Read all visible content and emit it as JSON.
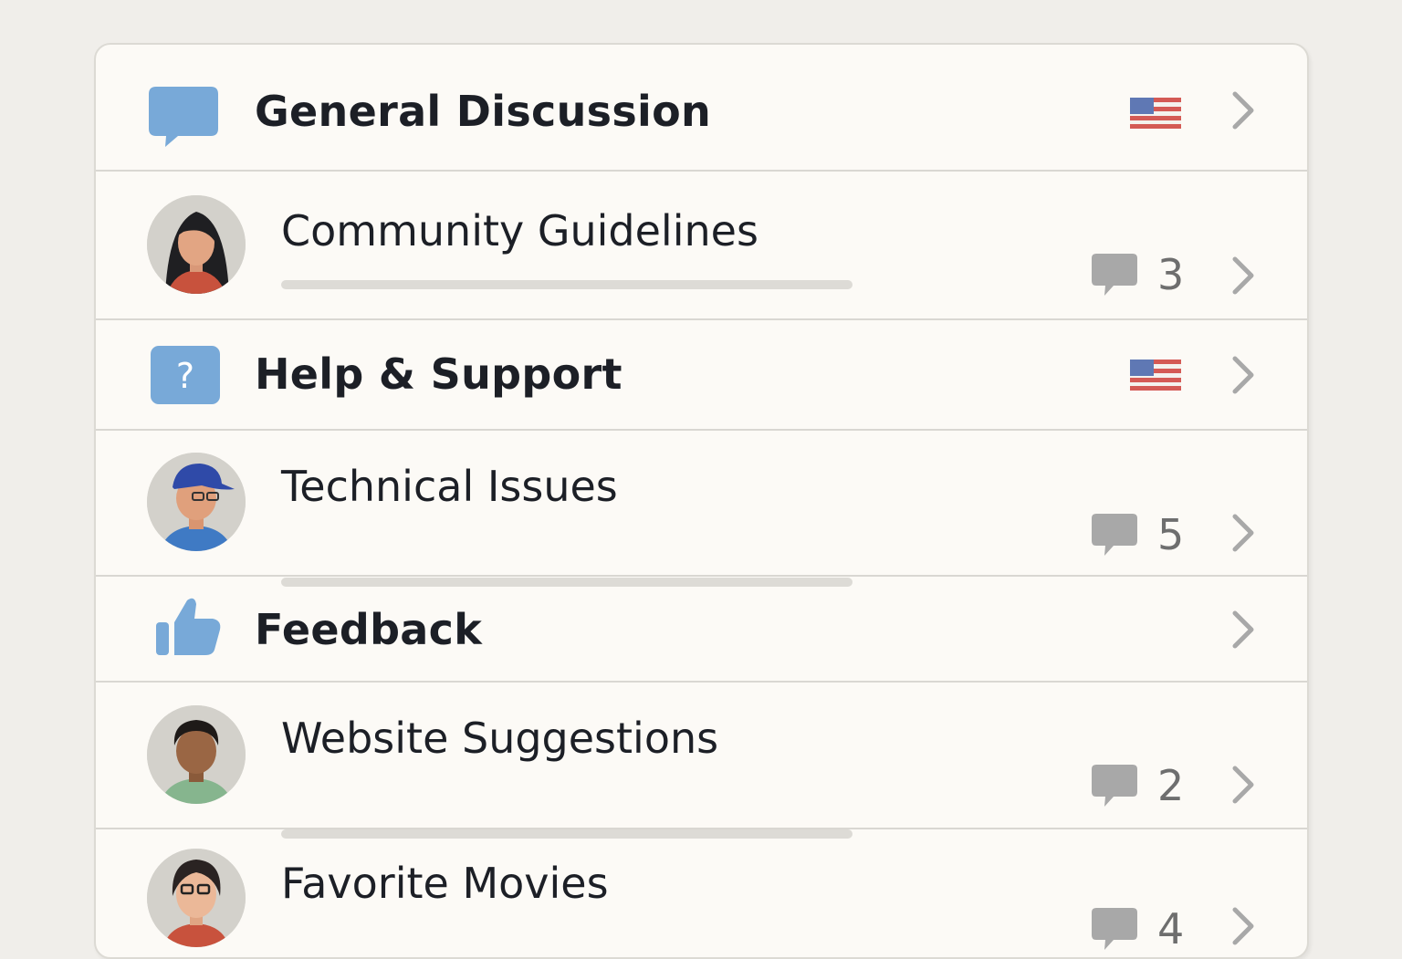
{
  "categories": [
    {
      "title": "General Discussion",
      "icon": "speech-bubble-icon",
      "flag": "us-flag-icon",
      "subforum": {
        "title": "Community Guidelines",
        "replies": "3",
        "avatar": "avatar-woman-dark-hair"
      }
    },
    {
      "title": "Help & Support",
      "icon": "question-icon",
      "flag": "us-flag-icon",
      "subforum": {
        "title": "Technical Issues",
        "replies": "5",
        "avatar": "avatar-man-blue-cap"
      }
    },
    {
      "title": "Feedback",
      "icon": "thumbs-up-icon",
      "subforum": {
        "title": "Website Suggestions",
        "replies": "2",
        "avatar": "avatar-man-green-shirt"
      }
    },
    {
      "title": "",
      "subforum": {
        "title": "Favorite Movies",
        "replies": "4",
        "avatar": "avatar-person-glasses"
      }
    }
  ],
  "colors": {
    "accent_blue": "#78a9d8",
    "reply_bubble": "#a8a8a8",
    "chevron": "#a8a8a8",
    "background": "#f0eeea",
    "card": "#fcfaf6"
  }
}
